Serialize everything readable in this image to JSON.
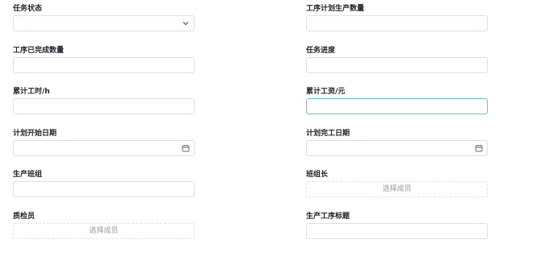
{
  "form": {
    "task_status": {
      "label": "任务状态",
      "icon": "chevron-down-icon"
    },
    "planned_qty": {
      "label": "工序计划生产数量"
    },
    "completed_qty": {
      "label": "工序已完成数量"
    },
    "task_progress": {
      "label": "任务进度"
    },
    "cumulative_hours": {
      "label": "累计工时/h"
    },
    "cumulative_wage": {
      "label": "累计工资/元",
      "state": "focused"
    },
    "plan_start_date": {
      "label": "计划开始日期",
      "icon": "calendar-icon"
    },
    "plan_end_date": {
      "label": "计划完工日期",
      "icon": "calendar-icon"
    },
    "production_team": {
      "label": "生产班组"
    },
    "team_leader": {
      "label": "班组长",
      "placeholder": "选择成员"
    },
    "qc_inspector": {
      "label": "质检员",
      "placeholder": "选择成员"
    },
    "process_title": {
      "label": "生产工序标题"
    }
  },
  "colors": {
    "border": "#dcdfe6",
    "focus_border": "#5ec9c2",
    "placeholder_text": "#999999"
  }
}
